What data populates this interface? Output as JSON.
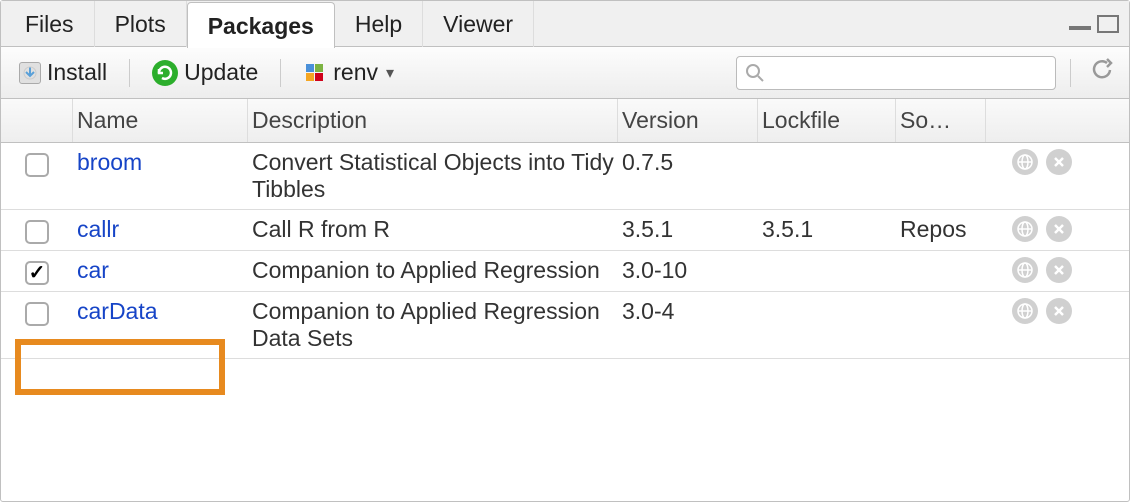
{
  "tabs": {
    "files": "Files",
    "plots": "Plots",
    "packages": "Packages",
    "help": "Help",
    "viewer": "Viewer"
  },
  "toolbar": {
    "install": "Install",
    "update": "Update",
    "renv": "renv"
  },
  "headers": {
    "name": "Name",
    "description": "Description",
    "version": "Version",
    "lockfile": "Lockfile",
    "source": "So…"
  },
  "packages": [
    {
      "checked": false,
      "name": "broom",
      "description": "Convert Statistical Objects into Tidy Tibbles",
      "version": "0.7.5",
      "lockfile": "",
      "source": ""
    },
    {
      "checked": false,
      "name": "callr",
      "description": "Call R from R",
      "version": "3.5.1",
      "lockfile": "3.5.1",
      "source": "Repos"
    },
    {
      "checked": true,
      "name": "car",
      "description": "Companion to Applied Regression",
      "version": "3.0-10",
      "lockfile": "",
      "source": ""
    },
    {
      "checked": false,
      "name": "carData",
      "description": "Companion to Applied Regression Data Sets",
      "version": "3.0-4",
      "lockfile": "",
      "source": ""
    }
  ],
  "search": {
    "placeholder": ""
  }
}
